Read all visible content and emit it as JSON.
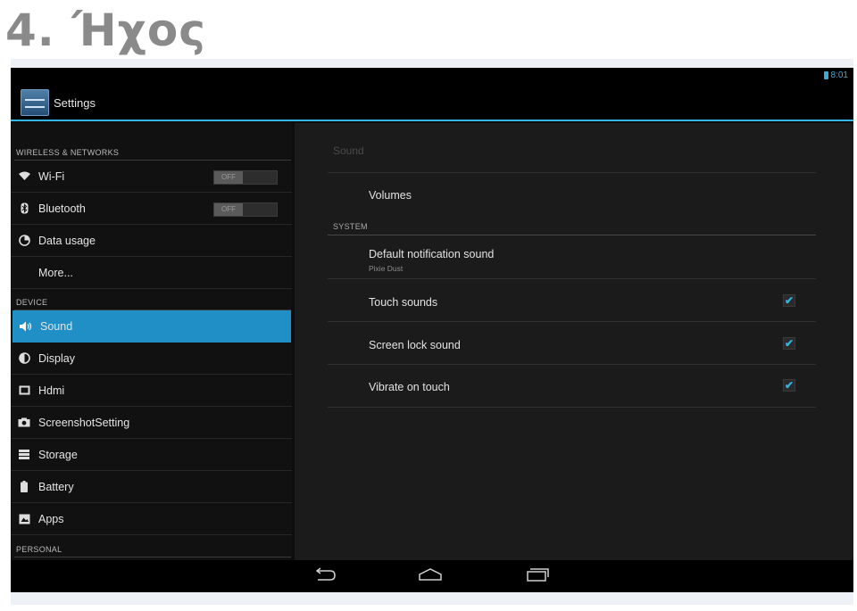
{
  "page_heading": "4. Ήχος",
  "status": {
    "time": "8:01"
  },
  "app": {
    "title": "Settings"
  },
  "left_pane": {
    "sections": {
      "wireless": "WIRELESS & NETWORKS",
      "device": "DEVICE",
      "personal": "PERSONAL"
    },
    "items": [
      {
        "label": "Wi-Fi",
        "icon": "wifi-icon",
        "toggle": "OFF"
      },
      {
        "label": "Bluetooth",
        "icon": "bluetooth-icon",
        "toggle": "OFF"
      },
      {
        "label": "Data usage",
        "icon": "data-usage-icon"
      },
      {
        "label": "More..."
      },
      {
        "label": "Sound",
        "icon": "volume-icon",
        "selected": true
      },
      {
        "label": "Display",
        "icon": "brightness-icon"
      },
      {
        "label": "Hdmi",
        "icon": "hdmi-icon"
      },
      {
        "label": "ScreenshotSetting",
        "icon": "camera-icon"
      },
      {
        "label": "Storage",
        "icon": "storage-icon"
      },
      {
        "label": "Battery",
        "icon": "battery-icon"
      },
      {
        "label": "Apps",
        "icon": "apps-icon"
      }
    ]
  },
  "right_pane": {
    "title": "Sound",
    "volumes": "Volumes",
    "system_header": "SYSTEM",
    "default_notification": {
      "label": "Default notification sound",
      "value": "Pixie Dust"
    },
    "options": [
      {
        "label": "Touch sounds",
        "checked": true
      },
      {
        "label": "Screen lock sound",
        "checked": true
      },
      {
        "label": "Vibrate on touch",
        "checked": true
      }
    ],
    "check_glyph": "✔"
  },
  "colors": {
    "accent": "#33b5e5",
    "selected": "#1f8fc6",
    "heading": "#8a8a8a"
  }
}
